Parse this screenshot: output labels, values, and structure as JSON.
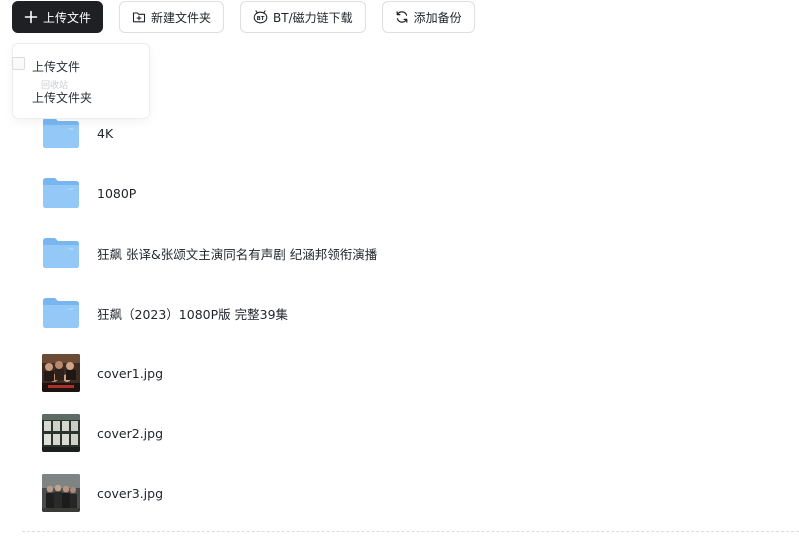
{
  "toolbar": {
    "upload_label": "上传文件",
    "new_folder_label": "新建文件夹",
    "bt_magnet_label": "BT/磁力链下载",
    "backup_label": "添加备份"
  },
  "upload_menu": {
    "upload_file_label": "上传文件",
    "upload_folder_label": "上传文件夹",
    "ghost_text": "回收站"
  },
  "files": [
    {
      "name": "4K",
      "type": "folder"
    },
    {
      "name": "1080P",
      "type": "folder"
    },
    {
      "name": "狂飙 张译&张颂文主演同名有声剧  纪涵邦领衔演播",
      "type": "folder"
    },
    {
      "name": "狂飙（2023）1080P版 完整39集",
      "type": "folder"
    },
    {
      "name": "cover1.jpg",
      "type": "image"
    },
    {
      "name": "cover2.jpg",
      "type": "image"
    },
    {
      "name": "cover3.jpg",
      "type": "image"
    }
  ],
  "colors": {
    "primary_button": "#1f2023",
    "folder_blue": "#8fc5f6",
    "folder_tab": "#79b6f0"
  },
  "icons": {
    "upload": "plus-icon",
    "new_folder": "folder-plus-icon",
    "bt": "bt-icon",
    "backup": "sync-icon",
    "folder": "folder-icon",
    "image": "image-thumbnail"
  }
}
